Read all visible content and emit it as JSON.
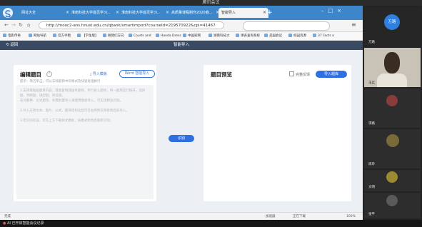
{
  "meeting": {
    "title": "腾讯会议",
    "bottom_label": "AI 已开启智能会议记录"
  },
  "browser": {
    "tabs": [
      {
        "label": "网址大全"
      },
      {
        "label": "淮南科技大学首页学习..."
      },
      {
        "label": "淮南科技大学首页学习..."
      },
      {
        "label": "高质量课程制作2020春..."
      },
      {
        "label": "智能导入"
      }
    ],
    "url": "http://mooc2-ans.hnust.edu.cn/qbank/smartimport?courseId=219570922&cpi=41467",
    "bookmarks": [
      "电影传奇",
      "网站导航",
      "官方手稿",
      "【学生版】",
      "要我们方向",
      "Courts and",
      "Honda Dress",
      "中国知网",
      "湖南科技大",
      "课表查询系统",
      "美国会议",
      "校园资源",
      "37 Facts a"
    ]
  },
  "app": {
    "back_label": "返回",
    "title": "智能导入"
  },
  "editor": {
    "title": "编辑题目",
    "desc": "提示：简洁单击，可以去除题目中的格式及快速处理换行",
    "import_template_label": "导入模板",
    "word_import_label": "Word 智能导入",
    "hints": [
      "1.支持或粘贴题目内容，或者复制或插件题目，单行录入题目，每一题用空行隔开；选择题、判断题、填空题、简答题、",
      "  名词解释、论述题等，如需批量导入请使用模板导入，可实现精准识别。",
      "2.导入支持文本、图片、公式，题目结构化后可在右侧预览和修改后再导入。",
      "3.若识别有误，可在上方下载样式模板，按模式修改后重新识别。"
    ]
  },
  "center": {
    "recognize_label": "识别"
  },
  "preview": {
    "title": "题目预览",
    "checkbox_label": "完整反馈",
    "import_label": "导入题库"
  },
  "statusbar": {
    "left": "完成",
    "right_items": [
      "加速器",
      "正在下载",
      "100%"
    ]
  },
  "participants": [
    {
      "name": "万路",
      "initials": "万路",
      "color": "#2f7fe0"
    },
    {
      "name": "王兵",
      "color": "#6b8a5a"
    },
    {
      "name": "李路",
      "color": "#8a3c3c"
    },
    {
      "name": "周玲",
      "color": "#7a6a3a"
    },
    {
      "name": "文明",
      "color": "#9a8a30"
    },
    {
      "name": "张平",
      "color": "#5a5a5a"
    },
    {
      "name": "陈宇",
      "color": "#3c5a7a"
    }
  ],
  "colors": {
    "accent": "#2f6fe0",
    "tabbar": "#3c86c9",
    "apphead": "#3a4a63"
  }
}
